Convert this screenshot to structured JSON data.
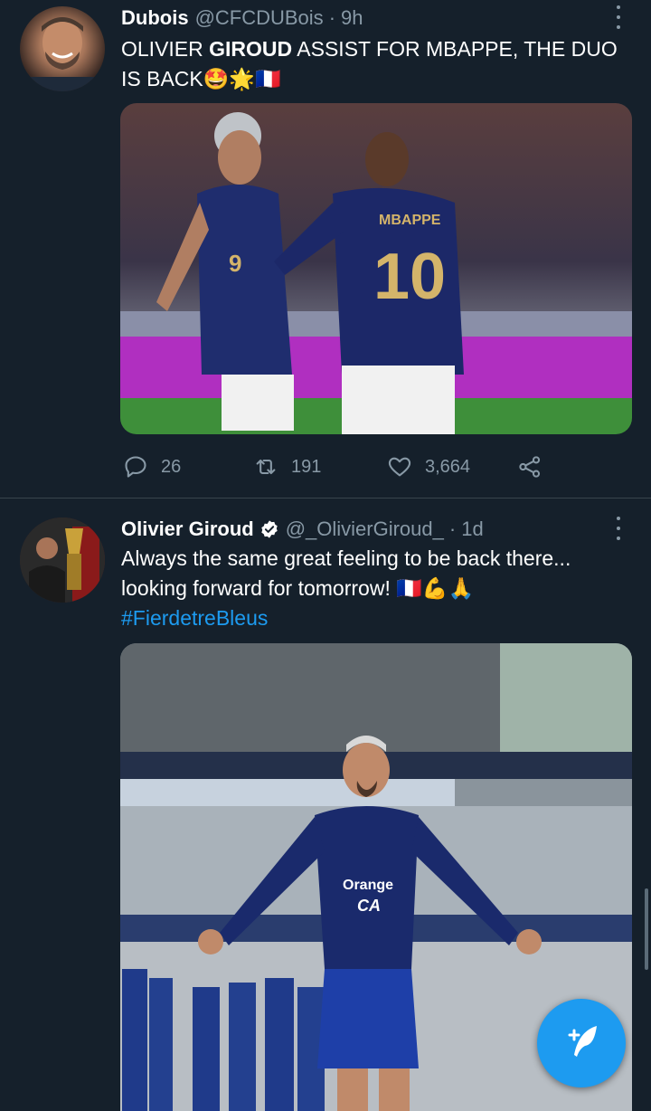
{
  "colors": {
    "background": "#15202b",
    "text": "#ffffff",
    "secondary": "#8899a6",
    "accent": "#1d9bf0",
    "divider": "#38444d"
  },
  "tweets": [
    {
      "name": "Dubois",
      "handle": "@CFCDUBois",
      "separator": "·",
      "time": "9h",
      "text_parts": [
        "OLIVIER ",
        "GIROUD",
        " ASSIST FOR MBAPPE, THE DUO IS BACK",
        "🤩🌟🇫🇷"
      ],
      "media": {
        "jersey_left": "9",
        "jersey_right_name": "MBAPPE",
        "jersey_right_number": "10"
      },
      "stats": {
        "replies": "26",
        "retweets": "191",
        "likes": "3,664"
      }
    },
    {
      "name": "Olivier Giroud",
      "handle": "@_OlivierGiroud_",
      "separator": "·",
      "time": "1d",
      "text_line1": "Always the same great feeling to be back there...",
      "text_line2": "looking forward for tomorrow! 🇫🇷💪🙏",
      "hashtag": "#FierdetreBleus",
      "media": {
        "sponsor_line1": "Orange",
        "sponsor_line2": "CA"
      }
    }
  ],
  "icons": {
    "reply": "reply-icon",
    "retweet": "retweet-icon",
    "like": "heart-icon",
    "share": "share-icon",
    "more": "more-vertical-icon",
    "verified": "verified-badge-icon",
    "compose": "compose-tweet-icon"
  }
}
